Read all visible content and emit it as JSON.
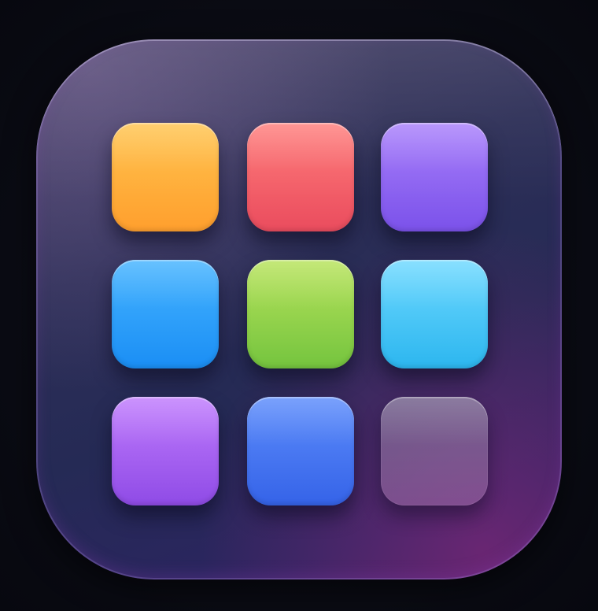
{
  "icon": {
    "name": "app-grid-icon",
    "grid": {
      "rows": 3,
      "columns": 3
    },
    "tiles": [
      {
        "row": 0,
        "col": 0,
        "color": "#ffb03c",
        "name": "orange"
      },
      {
        "row": 0,
        "col": 1,
        "color": "#f4606a",
        "name": "red"
      },
      {
        "row": 0,
        "col": 2,
        "color": "#9066f2",
        "name": "violet"
      },
      {
        "row": 1,
        "col": 0,
        "color": "#2fa2fa",
        "name": "blue"
      },
      {
        "row": 1,
        "col": 1,
        "color": "#98d44e",
        "name": "green"
      },
      {
        "row": 1,
        "col": 2,
        "color": "#4cc8f7",
        "name": "cyan"
      },
      {
        "row": 2,
        "col": 0,
        "color": "#a865f2",
        "name": "purple"
      },
      {
        "row": 2,
        "col": 1,
        "color": "#4978f2",
        "name": "indigo"
      },
      {
        "row": 2,
        "col": 2,
        "color": "#8e7aa8",
        "name": "translucent-glass"
      }
    ],
    "colors": {
      "background": "#0b0c15",
      "icon_base": "#2a2d58",
      "icon_glow": "#8c2882"
    }
  }
}
